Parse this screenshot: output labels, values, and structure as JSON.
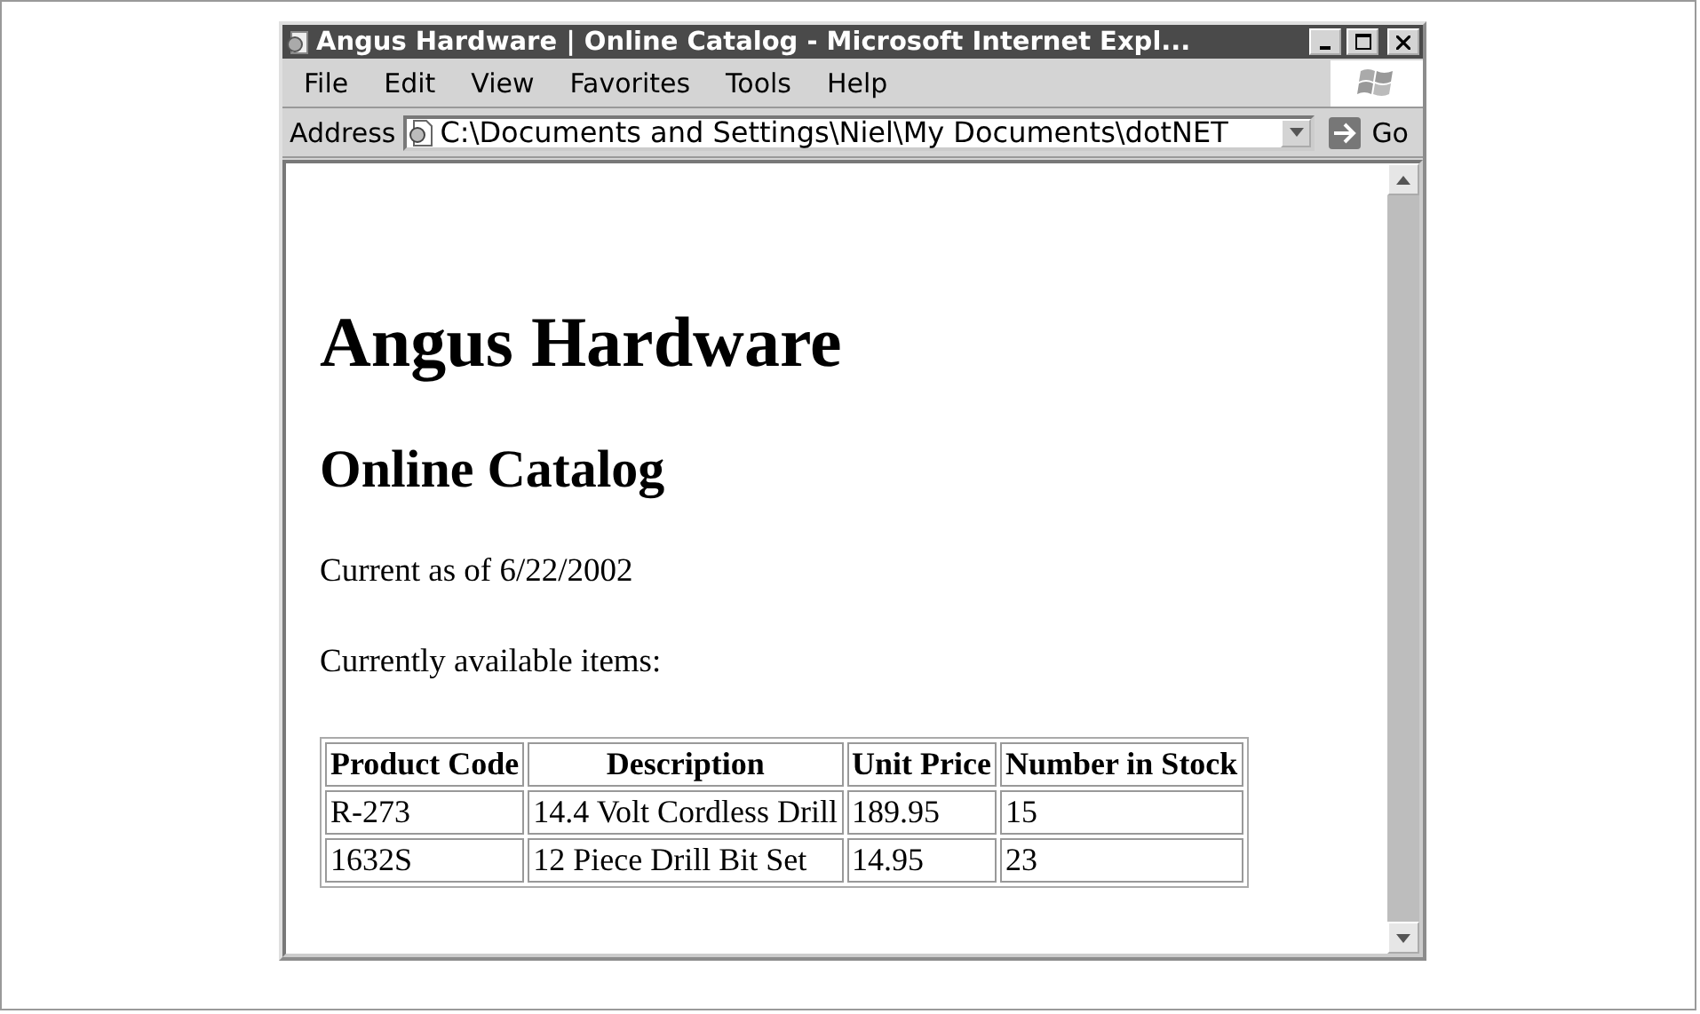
{
  "window": {
    "title": "Angus Hardware | Online Catalog - Microsoft Internet Expl..."
  },
  "menu": [
    "File",
    "Edit",
    "View",
    "Favorites",
    "Tools",
    "Help"
  ],
  "address": {
    "label": "Address",
    "value": "C:\\Documents and Settings\\Niel\\My Documents\\dotNET",
    "go": "Go"
  },
  "page": {
    "heading": "Angus Hardware",
    "subheading": "Online Catalog",
    "paragraphs": [
      "Current as of 6/22/2002",
      "Currently available items:"
    ]
  },
  "table": {
    "columns": [
      "Product Code",
      "Description",
      "Unit Price",
      "Number in Stock"
    ],
    "rows": [
      [
        "R-273",
        "14.4 Volt Cordless Drill",
        "189.95",
        "15"
      ],
      [
        "1632S",
        "12 Piece Drill Bit Set",
        "14.95",
        "23"
      ]
    ]
  }
}
